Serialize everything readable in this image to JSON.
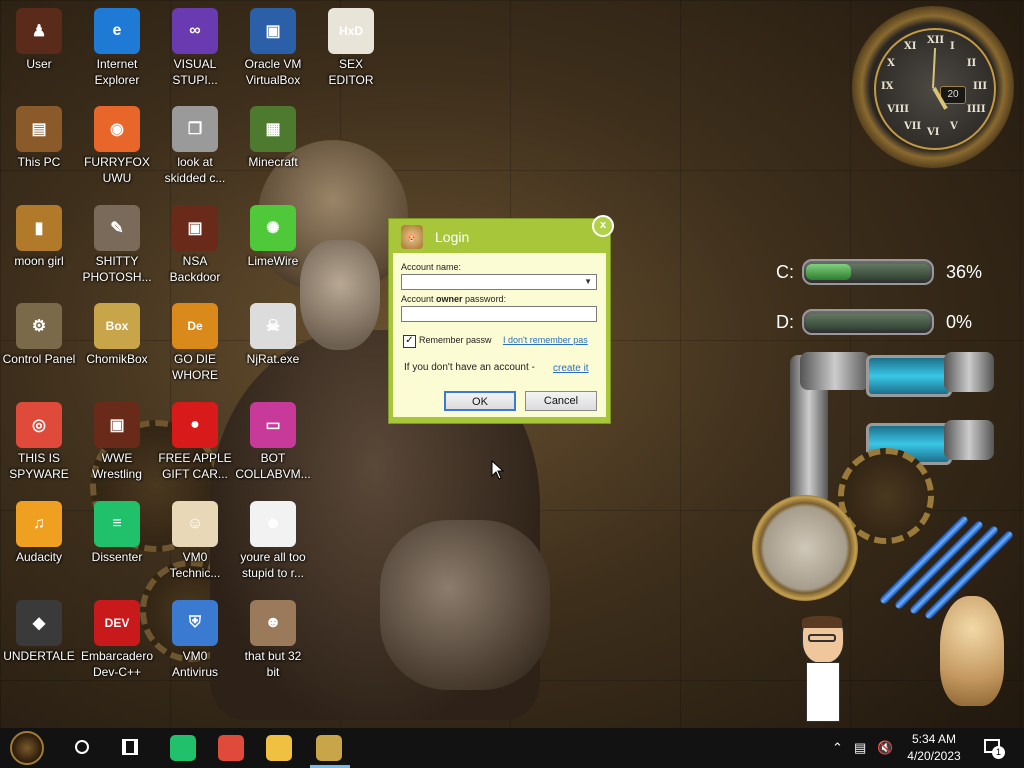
{
  "desktop": {
    "icons": [
      {
        "label": "User",
        "icon": "user-folder-icon",
        "color": "#5a2a1a",
        "glyph": "♟"
      },
      {
        "label": "Internet\nExplorer",
        "icon": "edge-icon",
        "color": "#1f7ad6",
        "glyph": "e"
      },
      {
        "label": "VISUAL\nSTUPI...",
        "icon": "visual-studio-icon",
        "color": "#6a3ab0",
        "glyph": "∞"
      },
      {
        "label": "Oracle VM\nVirtualBox",
        "icon": "virtualbox-icon",
        "color": "#2b5fa8",
        "glyph": "▣"
      },
      {
        "label": "SEX\nEDITOR",
        "icon": "hex-editor-icon",
        "color": "#e9e4d8",
        "glyph": "HxD"
      },
      {
        "label": "This PC",
        "icon": "this-pc-icon",
        "color": "#8a5a2a",
        "glyph": "▤"
      },
      {
        "label": "FURRYFOX\nUWU",
        "icon": "firefox-icon",
        "color": "#e8662a",
        "glyph": "◉"
      },
      {
        "label": "look at\nskidded c...",
        "icon": "copy-files-icon",
        "color": "#9a9a9a",
        "glyph": "❐"
      },
      {
        "label": "Minecraft",
        "icon": "minecraft-icon",
        "color": "#4d7a2e",
        "glyph": "▦"
      },
      {
        "label": "moon girl",
        "icon": "folder-icon",
        "color": "#b07a2a",
        "glyph": "▮"
      },
      {
        "label": "SHITTY\nPHOTOSH...",
        "icon": "gimp-icon",
        "color": "#7a6a5a",
        "glyph": "✎"
      },
      {
        "label": "NSA\nBackdoor",
        "icon": "folder-icon",
        "color": "#6a2a1a",
        "glyph": "▣"
      },
      {
        "label": "LimeWire",
        "icon": "limewire-icon",
        "color": "#4fc93a",
        "glyph": "✺"
      },
      {
        "label": "Control Panel",
        "icon": "control-panel-icon",
        "color": "#7a6a4a",
        "glyph": "⚙"
      },
      {
        "label": "ChomikBox",
        "icon": "chomikbox-icon",
        "color": "#c9a54a",
        "glyph": "Box"
      },
      {
        "label": "GO DIE\nWHORE",
        "icon": "de-app-icon",
        "color": "#d98a1a",
        "glyph": "De"
      },
      {
        "label": "NjRat.exe",
        "icon": "skull-icon",
        "color": "#dcdcdc",
        "glyph": "☠"
      },
      {
        "label": "THIS IS\nSPYWARE",
        "icon": "chrome-icon",
        "color": "#e04a3a",
        "glyph": "◎"
      },
      {
        "label": "WWE\nWrestling",
        "icon": "wrestling-icon",
        "color": "#6a2a1a",
        "glyph": "▣"
      },
      {
        "label": "FREE APPLE\nGIFT CAR...",
        "icon": "apple-icon",
        "color": "#d81a1a",
        "glyph": "●"
      },
      {
        "label": "BOT\nCOLLABVM...",
        "icon": "monitor-icon",
        "color": "#c83a9a",
        "glyph": "▭"
      },
      {
        "label": "Audacity",
        "icon": "audacity-icon",
        "color": "#f0a020",
        "glyph": "♫"
      },
      {
        "label": "Dissenter",
        "icon": "dissenter-icon",
        "color": "#21c06a",
        "glyph": "≡"
      },
      {
        "label": "VM0\nTechnic...",
        "icon": "technician-icon",
        "color": "#e8d8b8",
        "glyph": "☺"
      },
      {
        "label": "youre all too\nstupid to r...",
        "icon": "portrait-image-icon",
        "color": "#f2f2f2",
        "glyph": "☻"
      },
      {
        "label": "UNDERTALE",
        "icon": "unity-icon",
        "color": "#3a3a3a",
        "glyph": "◆"
      },
      {
        "label": "Embarcadero\nDev-C++",
        "icon": "devcpp-icon",
        "color": "#c81a1a",
        "glyph": "DEV"
      },
      {
        "label": "VM0\nAntivirus",
        "icon": "shield-icon",
        "color": "#3a7ad0",
        "glyph": "⛨"
      },
      {
        "label": "that but 32\nbit",
        "icon": "portrait-painting-icon",
        "color": "#9a7a5a",
        "glyph": "☻"
      }
    ]
  },
  "clock_widget": {
    "numerals": [
      "XII",
      "I",
      "II",
      "III",
      "IIII",
      "V",
      "VI",
      "VII",
      "VIII",
      "IX",
      "X",
      "XI"
    ],
    "date": "20"
  },
  "drive_meters": [
    {
      "letter": "C:",
      "percent_text": "36%",
      "fill": 0.36
    },
    {
      "letter": "D:",
      "percent_text": "0%",
      "fill": 0.0
    }
  ],
  "login_dialog": {
    "title": "Login",
    "close_glyph": "x",
    "account_name_label": "Account name:",
    "account_name_value": "",
    "password_label_prefix": "Account ",
    "password_label_bold": "owner",
    "password_label_suffix": " password:",
    "password_value": "",
    "remember_label": "Remember passw",
    "remember_checked": true,
    "forgot_link": "I don't remember pas",
    "no_account_text": "If you don't have an account - ",
    "create_link": "create it",
    "ok_label": "OK",
    "cancel_label": "Cancel",
    "accent": "#a8c63a"
  },
  "taskbar": {
    "time": "5:34 AM",
    "date": "4/20/2023",
    "notification_count": "1",
    "apps": [
      {
        "name": "dissenter-taskbar-icon",
        "color": "#21c06a"
      },
      {
        "name": "chrome-taskbar-icon",
        "color": "#e04a3a"
      },
      {
        "name": "file-explorer-taskbar-icon",
        "color": "#f0c040"
      },
      {
        "name": "chomikbox-taskbar-icon",
        "color": "#c9a54a"
      }
    ]
  }
}
